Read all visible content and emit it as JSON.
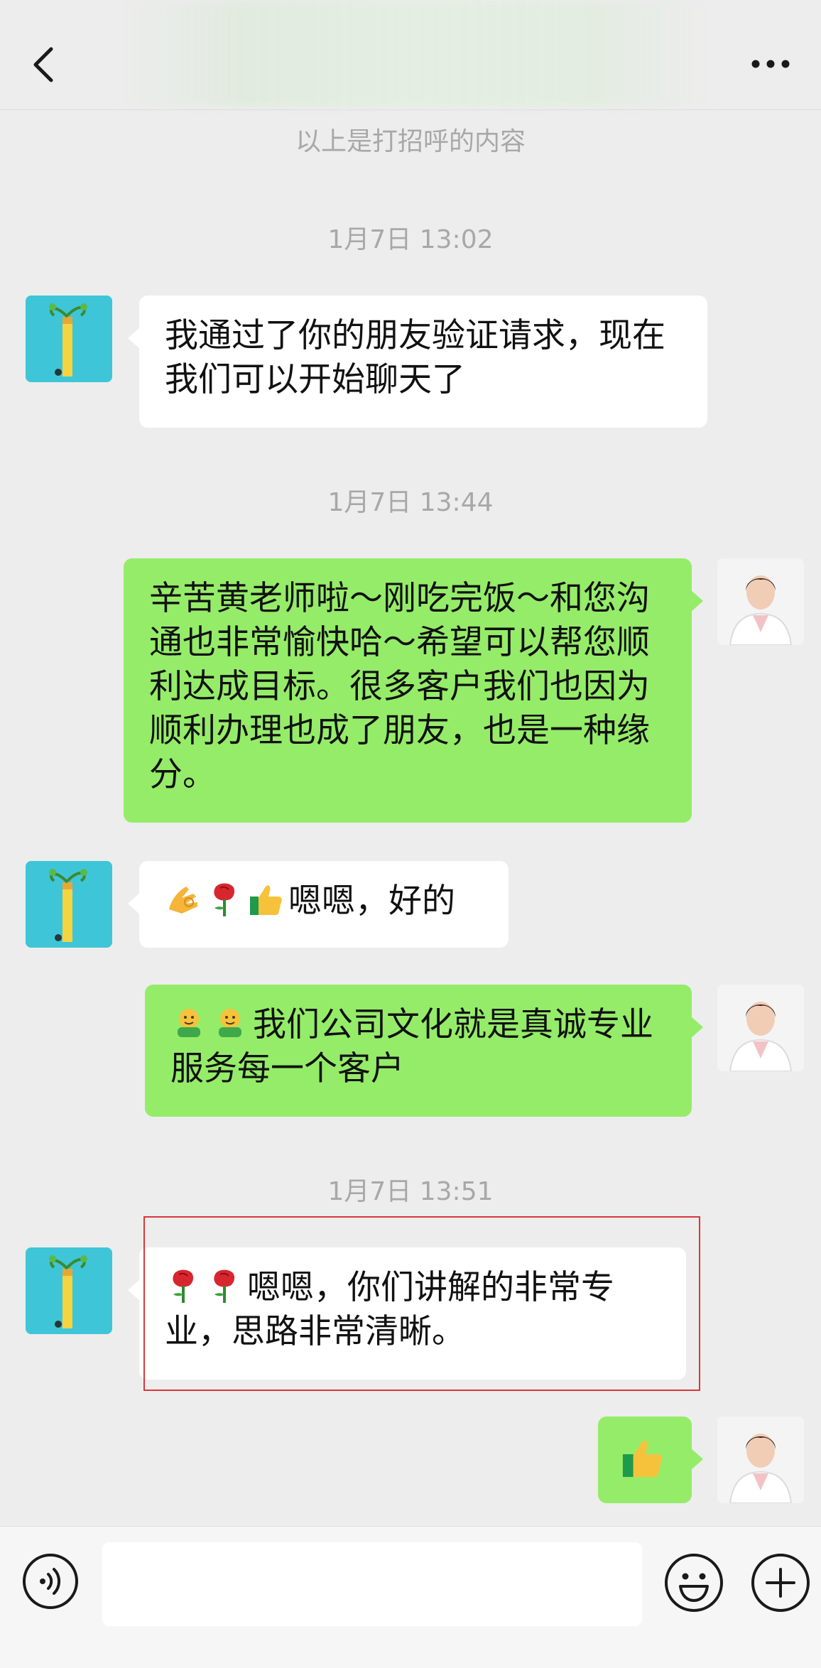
{
  "header": {
    "back_icon": "chevron-left-icon",
    "more_icon": "more-dots-icon"
  },
  "system_note": "以上是打招呼的内容",
  "timestamps": [
    "1月7日 13:02",
    "1月7日 13:44",
    "1月7日 13:51"
  ],
  "messages": [
    {
      "side": "left",
      "text": "我通过了你的朋友验证请求，现在我们可以开始聊天了"
    },
    {
      "side": "right",
      "text": "辛苦黄老师啦～刚吃完饭～和您沟通也非常愉快哈～希望可以帮您顺利达成目标。很多客户我们也因为顺利办理也成了朋友，也是一种缘分。"
    },
    {
      "side": "left",
      "emoji": [
        "ok-hand-emoji",
        "rose-emoji",
        "thumbs-up-emoji"
      ],
      "text": "嗯嗯，好的"
    },
    {
      "side": "right",
      "emoji": [
        "hug-emoji",
        "hug-emoji"
      ],
      "text": "我们公司文化就是真诚专业服务每一个客户"
    },
    {
      "side": "left",
      "emoji": [
        "rose-emoji",
        "rose-emoji"
      ],
      "text": "嗯嗯，你们讲解的非常专业，思路非常清晰。",
      "highlighted": true
    },
    {
      "side": "right",
      "emoji": [
        "thumbs-up-emoji"
      ],
      "text": ""
    }
  ],
  "colors": {
    "background": "#ededed",
    "bubble_self": "#95ec69",
    "bubble_other": "#ffffff",
    "highlight": "#d8383a"
  },
  "input_bar": {
    "voice_icon": "voice-icon",
    "input_value": "",
    "emoji_icon": "smiley-icon",
    "plus_icon": "plus-circle-icon"
  }
}
